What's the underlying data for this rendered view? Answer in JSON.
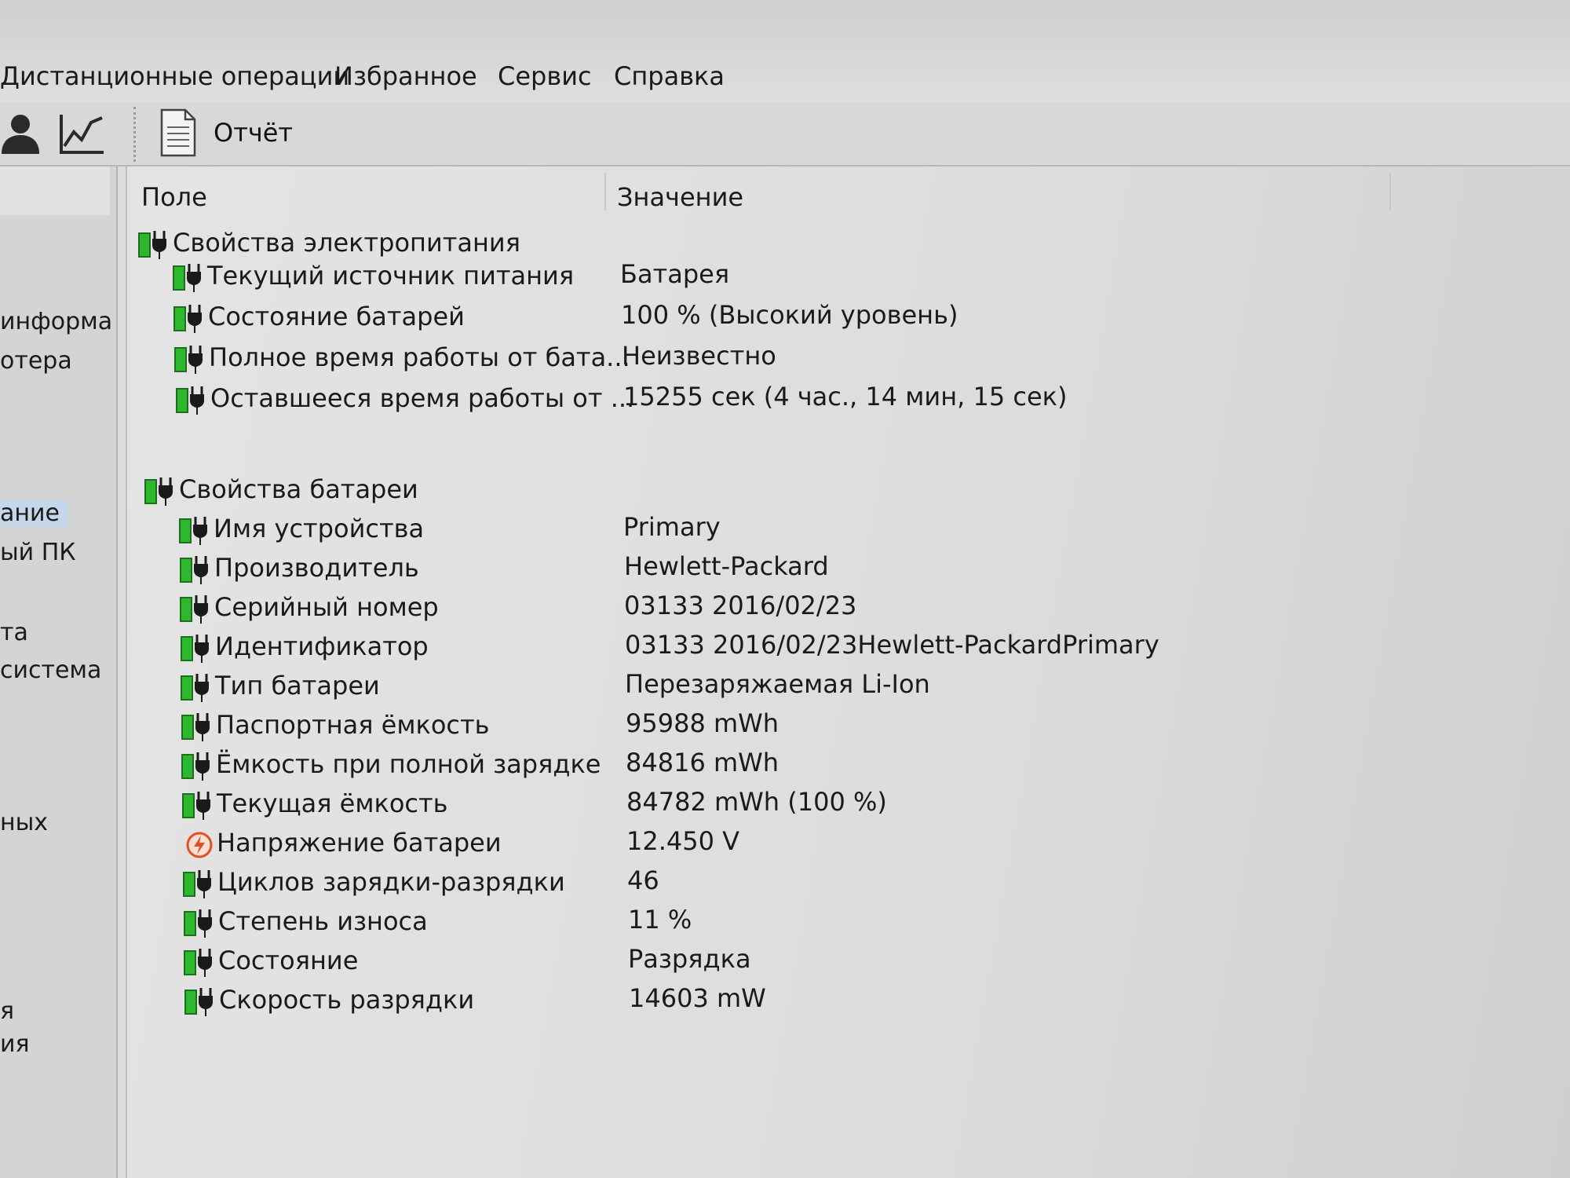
{
  "menu": {
    "items": [
      "Дистанционные операции",
      "Избранное",
      "Сервис",
      "Справка"
    ]
  },
  "toolbar": {
    "icons": [
      "user-icon",
      "chart-icon",
      "report-icon"
    ],
    "report_label": "Отчёт"
  },
  "sidebar": {
    "items": [
      "информа",
      "отера",
      "ание",
      "ый ПК",
      "та",
      "система",
      "ных",
      "я",
      "ия"
    ]
  },
  "table": {
    "columns": {
      "field": "Поле",
      "value": "Значение"
    },
    "groups": [
      {
        "title": "Свойства электропитания",
        "rows": [
          {
            "field": "Текущий источник питания",
            "value": "Батарея"
          },
          {
            "field": "Состояние батарей",
            "value": "100 % (Высокий уровень)"
          },
          {
            "field": "Полное время работы от бата...",
            "value": "Неизвестно"
          },
          {
            "field": "Оставшееся время работы от ...",
            "value": "15255 сек (4 час., 14 мин, 15 сек)"
          }
        ]
      },
      {
        "title": "Свойства батареи",
        "rows": [
          {
            "field": "Имя устройства",
            "value": "Primary"
          },
          {
            "field": "Производитель",
            "value": "Hewlett-Packard"
          },
          {
            "field": "Серийный номер",
            "value": "03133 2016/02/23"
          },
          {
            "field": "Идентификатор",
            "value": "03133 2016/02/23Hewlett-PackardPrimary"
          },
          {
            "field": "Тип батареи",
            "value": "Перезаряжаемая Li-Ion"
          },
          {
            "field": "Паспортная ёмкость",
            "value": "95988 mWh"
          },
          {
            "field": "Ёмкость при полной зарядке",
            "value": "84816 mWh"
          },
          {
            "field": "Текущая ёмкость",
            "value": "84782 mWh  (100 %)"
          },
          {
            "field": "Напряжение батареи",
            "value": "12.450 V",
            "icon": "voltage-icon"
          },
          {
            "field": "Циклов зарядки-разрядки",
            "value": "46"
          },
          {
            "field": "Степень износа",
            "value": "11 %"
          },
          {
            "field": "Состояние",
            "value": "Разрядка"
          },
          {
            "field": "Скорость разрядки",
            "value": "14603 mW"
          }
        ]
      }
    ]
  },
  "colors": {
    "battery_green": "#2eb82e",
    "selection": "#c4d8ea",
    "voltage_icon": "#e05020"
  }
}
